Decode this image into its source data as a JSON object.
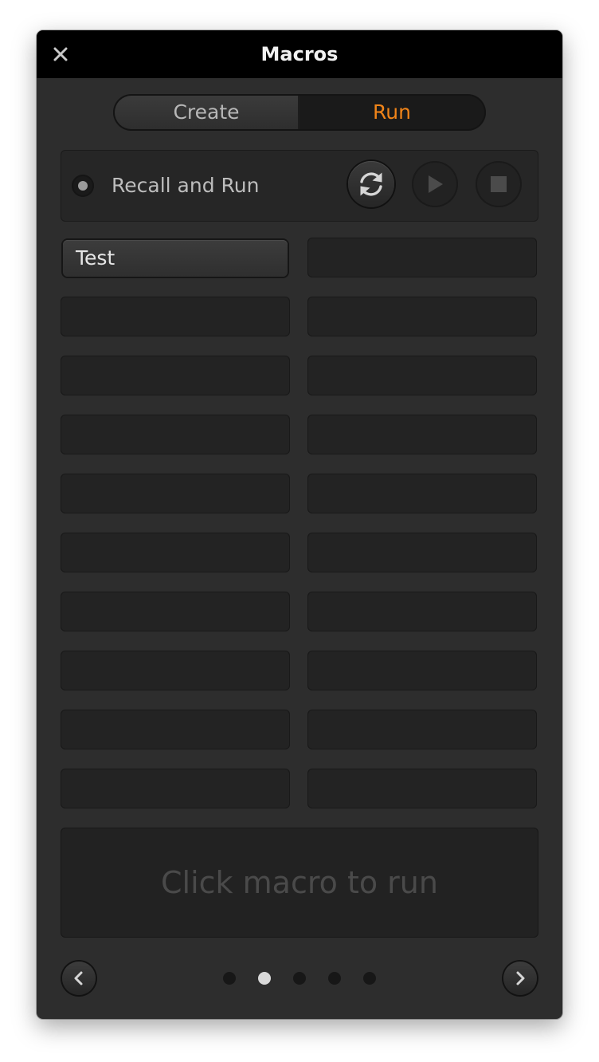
{
  "window": {
    "title": "Macros"
  },
  "tabs": [
    {
      "label": "Create",
      "active": false
    },
    {
      "label": "Run",
      "active": true
    }
  ],
  "accent_color": "#f08419",
  "recall": {
    "label": "Recall and Run",
    "selected": false
  },
  "controls": {
    "loop_icon": "loop-icon",
    "play_icon": "play-icon",
    "stop_icon": "stop-icon"
  },
  "macros": [
    {
      "label": "Test"
    },
    {
      "label": ""
    },
    {
      "label": ""
    },
    {
      "label": ""
    },
    {
      "label": ""
    },
    {
      "label": ""
    },
    {
      "label": ""
    },
    {
      "label": ""
    },
    {
      "label": ""
    },
    {
      "label": ""
    },
    {
      "label": ""
    },
    {
      "label": ""
    },
    {
      "label": ""
    },
    {
      "label": ""
    },
    {
      "label": ""
    },
    {
      "label": ""
    },
    {
      "label": ""
    },
    {
      "label": ""
    },
    {
      "label": ""
    },
    {
      "label": ""
    }
  ],
  "status_text": "Click macro to run",
  "pagination": {
    "pages": 5,
    "current": 2
  }
}
